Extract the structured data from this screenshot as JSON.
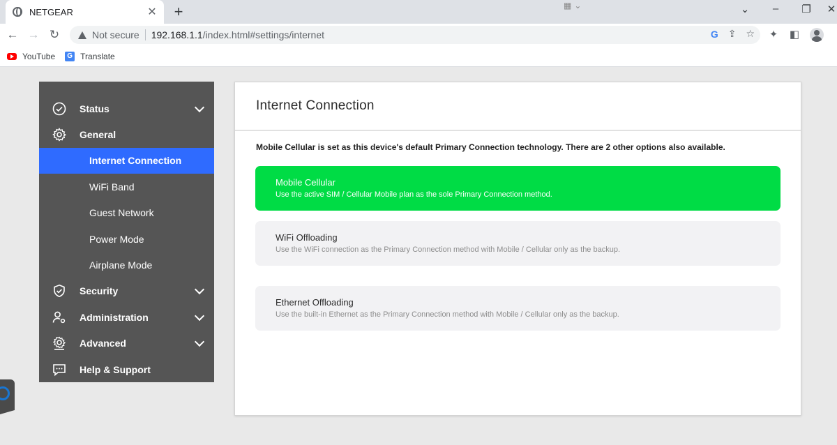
{
  "browser": {
    "tab_title": "NETGEAR",
    "tab_close": "✕",
    "new_tab": "+",
    "security_label": "Not secure",
    "url_host": "192.168.1.1",
    "url_path": "/index.html#settings/internet",
    "bookmarks": [
      {
        "label": "YouTube",
        "icon": "youtube-icon"
      },
      {
        "label": "Translate",
        "icon": "translate-icon"
      }
    ]
  },
  "sidebar": {
    "items": [
      {
        "label": "Status",
        "icon": "check-circle-icon",
        "expandable": true
      },
      {
        "label": "General",
        "icon": "gear-icon",
        "expandable": false
      },
      {
        "label": "Security",
        "icon": "shield-icon",
        "expandable": true
      },
      {
        "label": "Administration",
        "icon": "admin-user-icon",
        "expandable": true
      },
      {
        "label": "Advanced",
        "icon": "advanced-gear-icon",
        "expandable": true
      },
      {
        "label": "Help & Support",
        "icon": "chat-icon",
        "expandable": false
      }
    ],
    "general_sub": [
      {
        "label": "Internet Connection",
        "active": true
      },
      {
        "label": "WiFi Band",
        "active": false
      },
      {
        "label": "Guest Network",
        "active": false
      },
      {
        "label": "Power Mode",
        "active": false
      },
      {
        "label": "Airplane Mode",
        "active": false
      }
    ]
  },
  "main": {
    "title": "Internet Connection",
    "intro": "Mobile Cellular is set as this device's default Primary Connection technology. There are 2 other options also available.",
    "options": [
      {
        "title": "Mobile Cellular",
        "desc": "Use the active SIM / Cellular Mobile plan as the sole Primary Connection method.",
        "selected": true
      },
      {
        "title": "WiFi Offloading",
        "desc": "Use the WiFi connection as the Primary Connection method with Mobile / Cellular only as the backup.",
        "selected": false
      },
      {
        "title": "Ethernet Offloading",
        "desc": "Use the built-in Ethernet as the Primary Connection method with Mobile / Cellular only as the backup.",
        "selected": false
      }
    ]
  },
  "colors": {
    "sidebar_bg": "#555555",
    "active_blue": "#2f6bff",
    "selected_green": "#00dc45",
    "option_bg": "#f2f2f4"
  }
}
